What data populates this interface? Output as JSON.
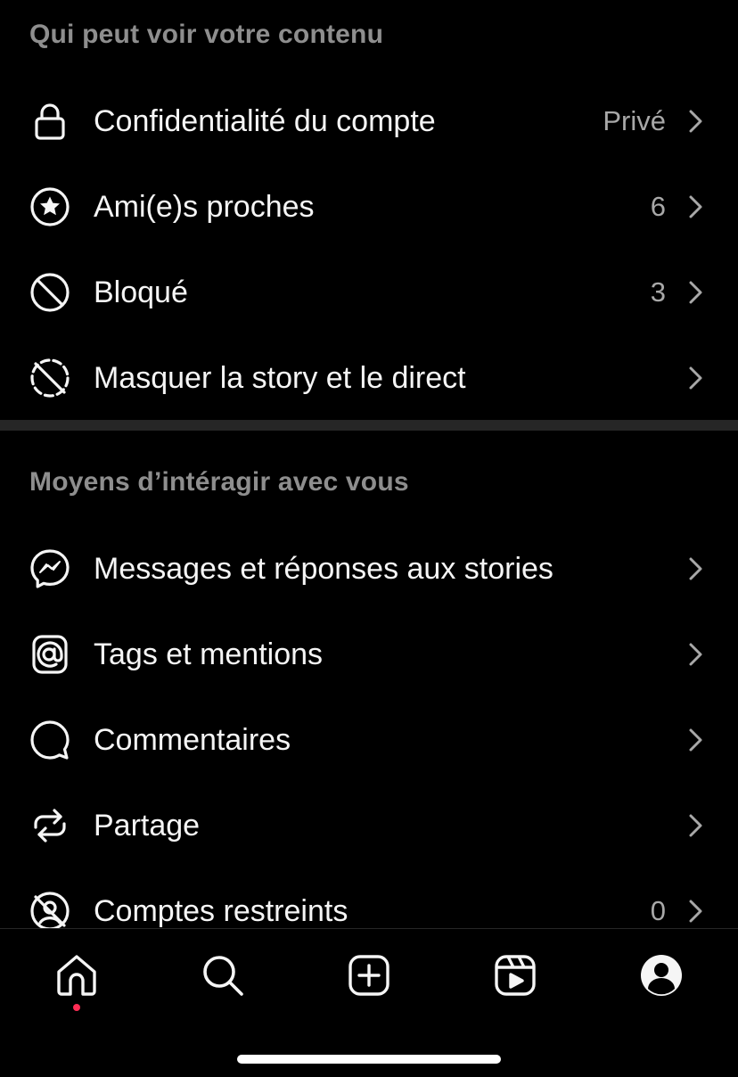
{
  "sections": [
    {
      "title": "Qui peut voir votre contenu",
      "items": [
        {
          "label": "Confidentialité du compte",
          "value": "Privé",
          "icon": "lock-icon"
        },
        {
          "label": "Ami(e)s proches",
          "value": "6",
          "icon": "star-circle-icon"
        },
        {
          "label": "Bloqué",
          "value": "3",
          "icon": "block-icon"
        },
        {
          "label": "Masquer la story et le direct",
          "value": "",
          "icon": "hide-story-icon"
        }
      ]
    },
    {
      "title": "Moyens d’intéragir avec vous",
      "items": [
        {
          "label": "Messages et réponses aux stories",
          "value": "",
          "icon": "messenger-icon"
        },
        {
          "label": "Tags et mentions",
          "value": "",
          "icon": "at-sign-icon"
        },
        {
          "label": "Commentaires",
          "value": "",
          "icon": "comment-icon"
        },
        {
          "label": "Partage",
          "value": "",
          "icon": "share-repeat-icon"
        },
        {
          "label": "Comptes restreints",
          "value": "0",
          "icon": "restricted-icon"
        }
      ]
    }
  ],
  "tabbar": {
    "tabs": [
      "home-icon",
      "search-icon",
      "create-icon",
      "reels-icon",
      "profile-icon"
    ],
    "notification_color": "#ff2d55"
  },
  "colors": {
    "background": "#000000",
    "text": "#f5f5f5",
    "secondary_text": "#8e8e8e",
    "value_text": "#a8a8a8",
    "divider": "#262626"
  }
}
